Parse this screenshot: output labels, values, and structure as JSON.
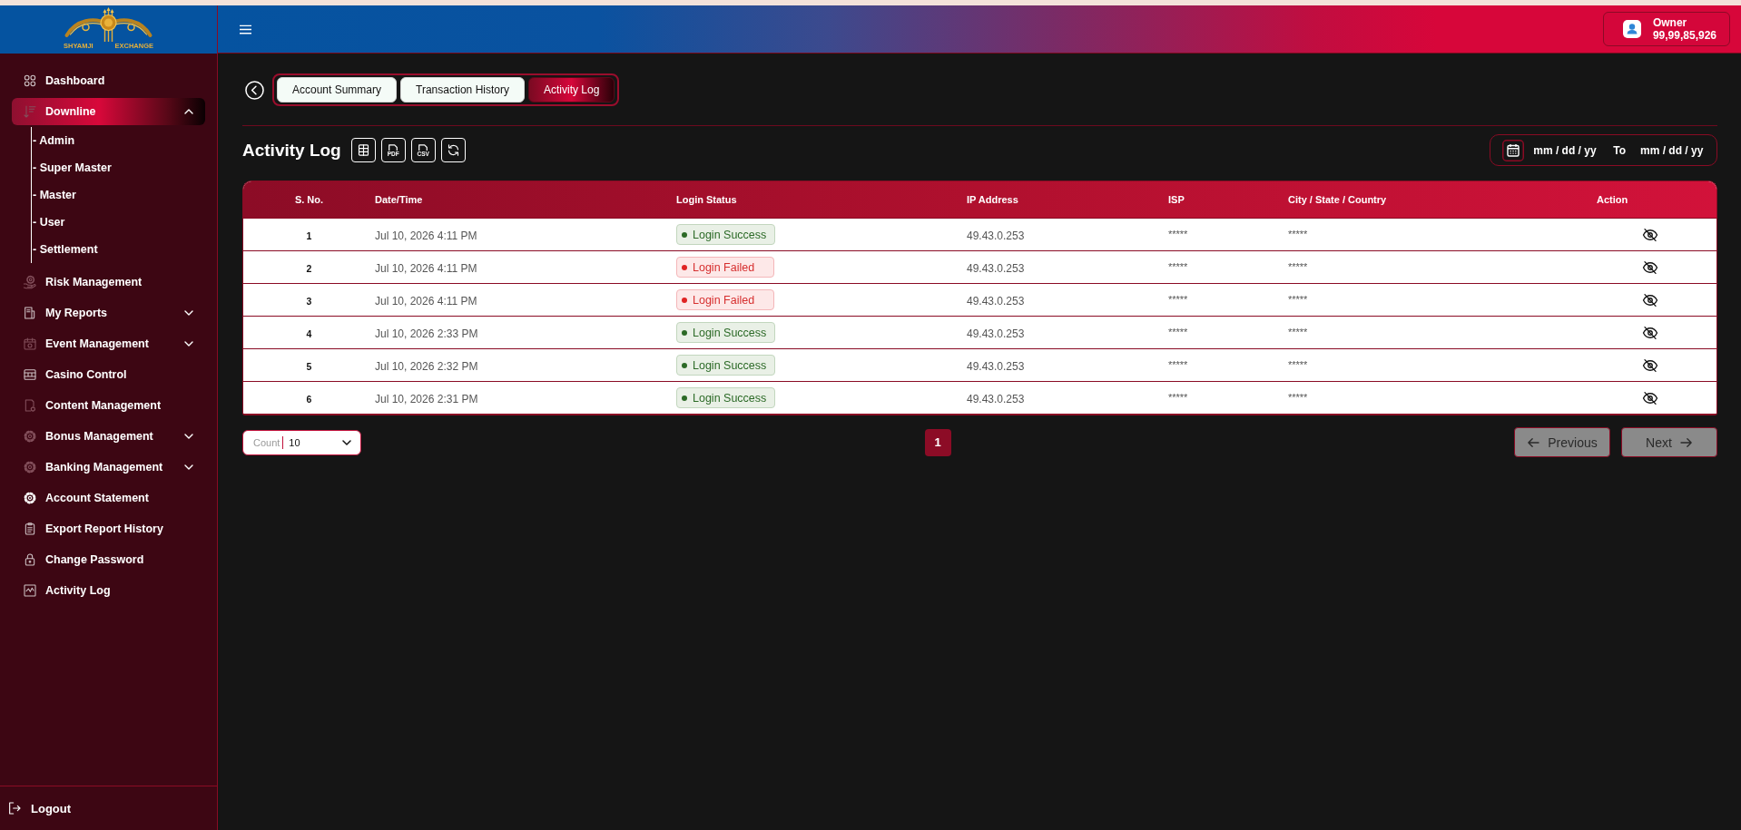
{
  "logo": {
    "left_text": "SHYAMJI",
    "right_text": "EXCHANGE"
  },
  "sidebar": {
    "items": [
      {
        "label": "Dashboard",
        "selected": false
      },
      {
        "label": "Downline",
        "selected": true,
        "expanded": true,
        "children": [
          {
            "label": "- Admin",
            "selected": false
          },
          {
            "label": "- Super Master",
            "selected": false
          },
          {
            "label": "- Master",
            "selected": false
          },
          {
            "label": "- User",
            "selected": false
          },
          {
            "label": "- Settlement",
            "selected": false
          }
        ]
      },
      {
        "label": "Risk Management",
        "selected": false
      },
      {
        "label": "My Reports",
        "selected": false,
        "expanded": false
      },
      {
        "label": "Event Management",
        "selected": false,
        "expanded": false
      },
      {
        "label": "Casino Control",
        "selected": false
      },
      {
        "label": "Content Management",
        "selected": false
      },
      {
        "label": "Bonus Management",
        "selected": false,
        "expanded": false
      },
      {
        "label": "Banking Management",
        "selected": false,
        "expanded": false
      },
      {
        "label": "Account Statement",
        "selected": false
      },
      {
        "label": "Export Report History",
        "selected": false
      },
      {
        "label": "Change Password",
        "selected": false
      },
      {
        "label": "Activity Log",
        "selected": false
      }
    ],
    "logout": {
      "label": "Logout"
    }
  },
  "header": {
    "user": {
      "role": "Owner",
      "balance": "99,99,85,926"
    }
  },
  "tabs": [
    {
      "label": "Account Summary",
      "selected": false
    },
    {
      "label": "Transaction History",
      "selected": false
    },
    {
      "label": "Activity Log",
      "selected": true
    }
  ],
  "page": {
    "title": "Activity Log",
    "export_buttons": [
      {
        "kind": "excel"
      },
      {
        "kind": "pdf",
        "label": "PDF"
      },
      {
        "kind": "csv",
        "label": "CSV"
      },
      {
        "kind": "refresh"
      }
    ],
    "date_range": {
      "from": {
        "placeholder": "mm / dd / yy"
      },
      "separator": "To",
      "to": {
        "placeholder": "mm / dd / yy"
      }
    }
  },
  "table": {
    "columns": [
      "S. No.",
      "Date/Time",
      "Login Status",
      "IP Address",
      "ISP",
      "City / State / Country",
      "Action"
    ],
    "rows": [
      {
        "s_no": "1",
        "date_time": "Jul 10, 2026 4:11 PM",
        "login_status": {
          "kind": "success",
          "label": "Login Success"
        },
        "ip_address": "49.43.0.253",
        "isp": "*****",
        "location": "*****"
      },
      {
        "s_no": "2",
        "date_time": "Jul 10, 2026 4:11 PM",
        "login_status": {
          "kind": "failed",
          "label": "Login Failed"
        },
        "ip_address": "49.43.0.253",
        "isp": "*****",
        "location": "*****"
      },
      {
        "s_no": "3",
        "date_time": "Jul 10, 2026 4:11 PM",
        "login_status": {
          "kind": "failed",
          "label": "Login Failed"
        },
        "ip_address": "49.43.0.253",
        "isp": "*****",
        "location": "*****"
      },
      {
        "s_no": "4",
        "date_time": "Jul 10, 2026 2:33 PM",
        "login_status": {
          "kind": "success",
          "label": "Login Success"
        },
        "ip_address": "49.43.0.253",
        "isp": "*****",
        "location": "*****"
      },
      {
        "s_no": "5",
        "date_time": "Jul 10, 2026 2:32 PM",
        "login_status": {
          "kind": "success",
          "label": "Login Success"
        },
        "ip_address": "49.43.0.253",
        "isp": "*****",
        "location": "*****"
      },
      {
        "s_no": "6",
        "date_time": "Jul 10, 2026 2:31 PM",
        "login_status": {
          "kind": "success",
          "label": "Login Success"
        },
        "ip_address": "49.43.0.253",
        "isp": "*****",
        "location": "*****"
      }
    ]
  },
  "pagination": {
    "count": {
      "label": "Count",
      "value": "10"
    },
    "pages": [
      {
        "label": "1",
        "selected": true
      }
    ],
    "previous": {
      "label": "Previous",
      "disabled": true
    },
    "next": {
      "label": "Next",
      "disabled": true
    }
  }
}
